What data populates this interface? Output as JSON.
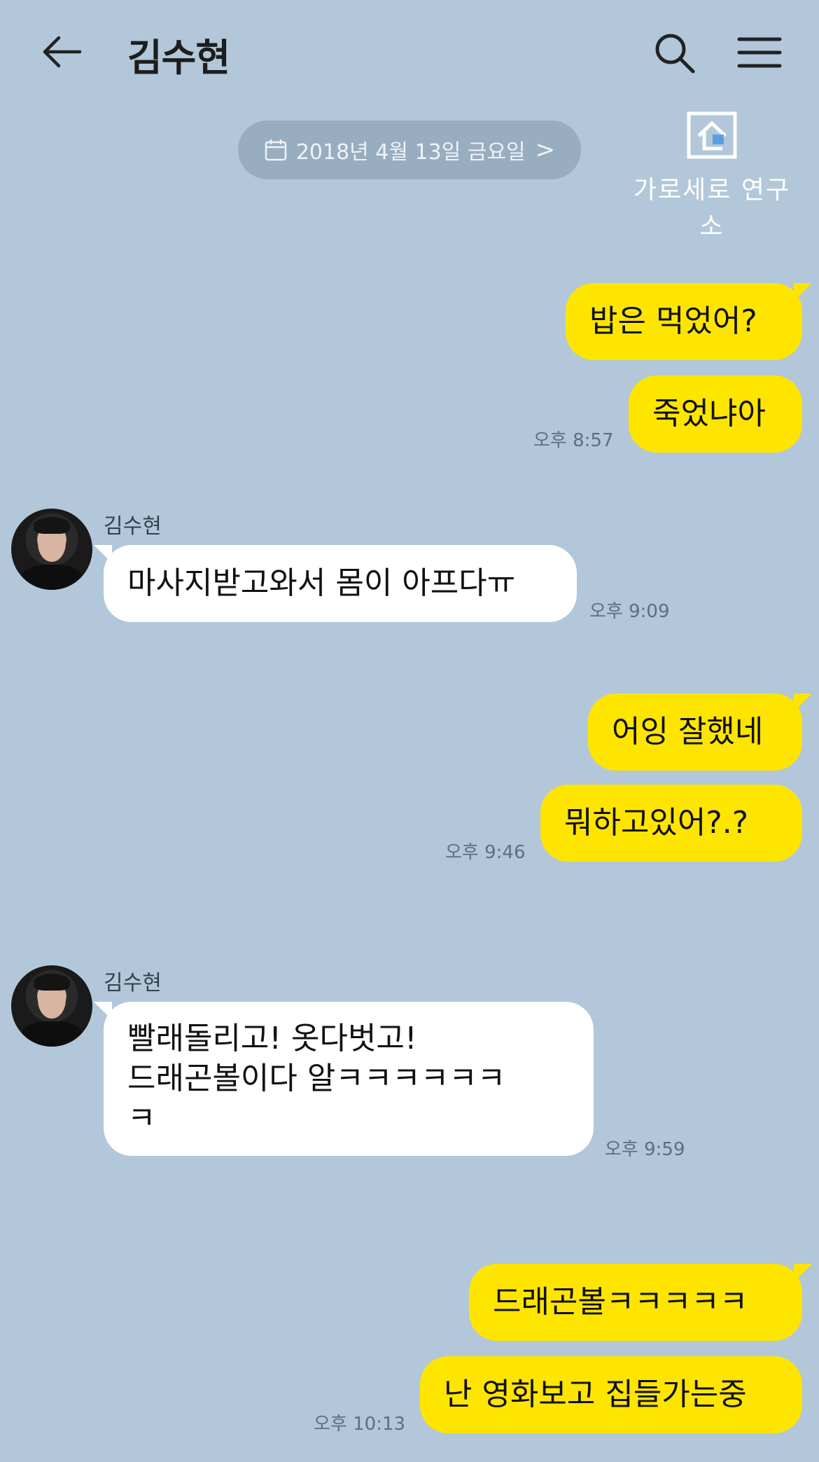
{
  "header": {
    "title": "김수현",
    "back_icon": "arrow-left-icon",
    "search_icon": "search-icon",
    "menu_icon": "hamburger-menu-icon"
  },
  "date_banner": {
    "text": "2018년 4월 13일 금요일",
    "icon": "calendar-icon",
    "chevron": ">"
  },
  "watermark": {
    "text": "가로세로 연구소",
    "icon": "house-logo-icon"
  },
  "colors": {
    "background": "#b2c7da",
    "my_bubble": "#fee500",
    "their_bubble": "#ffffff",
    "date_pill": "#99adc0"
  },
  "messages": [
    {
      "from": "me",
      "text": "밥은 먹었어?"
    },
    {
      "from": "me",
      "text": "죽었냐아",
      "time": "오후 8:57"
    },
    {
      "from": "them",
      "sender": "김수현",
      "text": "마사지받고와서 몸이 아프다ㅠ",
      "time": "오후 9:09"
    },
    {
      "from": "me",
      "text": "어잉 잘했네"
    },
    {
      "from": "me",
      "text": "뭐하고있어?.?",
      "time": "오후 9:46"
    },
    {
      "from": "them",
      "sender": "김수현",
      "lines": [
        "빨래돌리고! 옷다벗고!",
        "드래곤볼이다 알ㅋㅋㅋㅋㅋㅋ",
        "ㅋ"
      ],
      "time": "오후 9:59"
    },
    {
      "from": "me",
      "text": "드래곤볼ㅋㅋㅋㅋㅋ"
    },
    {
      "from": "me",
      "text": "난 영화보고 집들가는중",
      "time": "오후 10:13"
    }
  ]
}
